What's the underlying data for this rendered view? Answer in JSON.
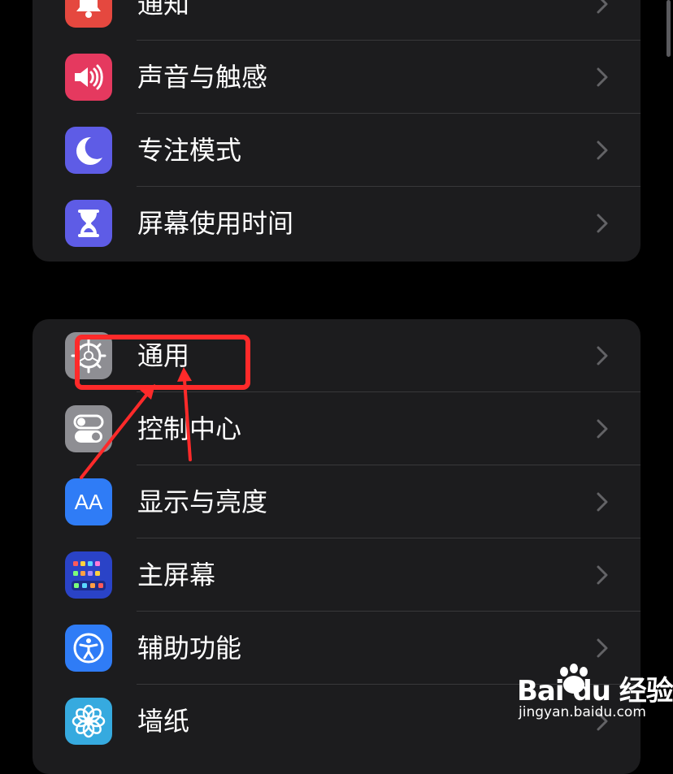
{
  "groups": [
    {
      "rows": [
        {
          "label": "通知",
          "icon": "bell-icon",
          "color": "#e5483f"
        },
        {
          "label": "声音与触感",
          "icon": "speaker-icon",
          "color": "#e5395f"
        },
        {
          "label": "专注模式",
          "icon": "moon-icon",
          "color": "#5e5ce6"
        },
        {
          "label": "屏幕使用时间",
          "icon": "hourglass-icon",
          "color": "#5e5ce6"
        }
      ]
    },
    {
      "rows": [
        {
          "label": "通用",
          "icon": "gear-icon",
          "color": "#8e8e93"
        },
        {
          "label": "控制中心",
          "icon": "toggles-icon",
          "color": "#8e8e93"
        },
        {
          "label": "显示与亮度",
          "icon": "text-size-icon",
          "color": "#2f7cf6",
          "icon_text": "AA"
        },
        {
          "label": "主屏幕",
          "icon": "home-grid-icon",
          "color": "#2a43c7"
        },
        {
          "label": "辅助功能",
          "icon": "accessibility-icon",
          "color": "#2f7cf6"
        },
        {
          "label": "墙纸",
          "icon": "wallpaper-flower-icon",
          "color": "#36aadf"
        }
      ]
    }
  ],
  "annotation": {
    "color": "#ff2a2a"
  },
  "watermark": {
    "logo": "Bai du 经验",
    "url": "jingyan.baidu.com"
  }
}
